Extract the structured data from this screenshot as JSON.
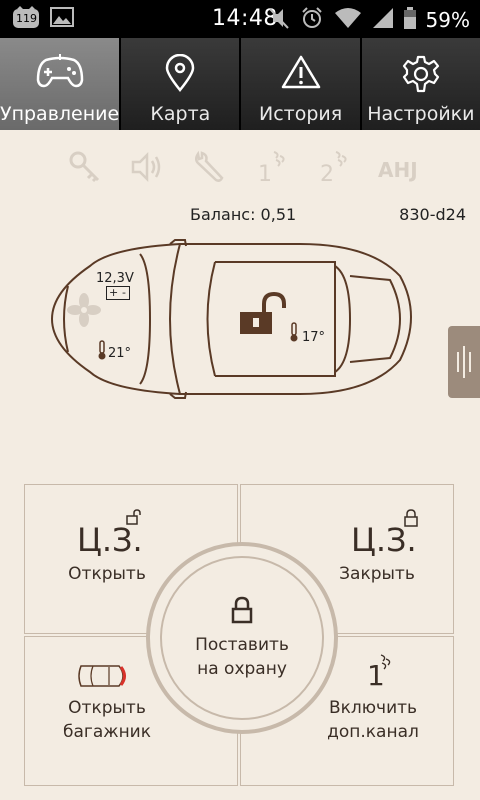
{
  "status_bar": {
    "notification_badge": "119",
    "time": "14:48",
    "battery_percent": "59%",
    "icons": [
      "notification-badge-icon",
      "image-icon",
      "mute-icon",
      "alarm-icon",
      "wifi-icon",
      "signal-icon",
      "battery-icon"
    ]
  },
  "tabs": [
    {
      "label": "Управление",
      "icon": "gamepad-icon",
      "active": true
    },
    {
      "label": "Карта",
      "icon": "map-pin-icon",
      "active": false
    },
    {
      "label": "История",
      "icon": "warning-icon",
      "active": false
    },
    {
      "label": "Настройки",
      "icon": "gear-icon",
      "active": false
    }
  ],
  "status_icons": [
    "key-icon",
    "speaker-icon",
    "wrench-icon",
    "channel-1-icon",
    "channel-2-icon",
    "ahj-icon"
  ],
  "status_icon_labels": {
    "ch1": "1",
    "ch2": "2",
    "ahj": "AHJ"
  },
  "info": {
    "balance": "Баланс: 0,51",
    "device_id": "830-d24"
  },
  "car": {
    "battery_voltage": "12,3V",
    "battery_plus": "+",
    "battery_minus": "-",
    "engine_temp": "21°",
    "cabin_temp": "17°"
  },
  "controls": {
    "cz_label": "Ц.З.",
    "unlock_label": "Открыть",
    "lock_label": "Закрыть",
    "arm_line1": "Поставить",
    "arm_line2": "на охрану",
    "trunk_line1": "Открыть",
    "trunk_line2": "багажник",
    "channel_number": "1",
    "channel_line1": "Включить",
    "channel_line2": "доп.канал"
  },
  "colors": {
    "background": "#f3ece2",
    "accent_brown": "#5a3a26",
    "panel_border": "#c7b9aa",
    "tab_active": "#7a7a7a",
    "tab_inactive": "#2a2a2a",
    "handle": "#9c8b7c",
    "trunk_highlight": "#d8322a"
  }
}
